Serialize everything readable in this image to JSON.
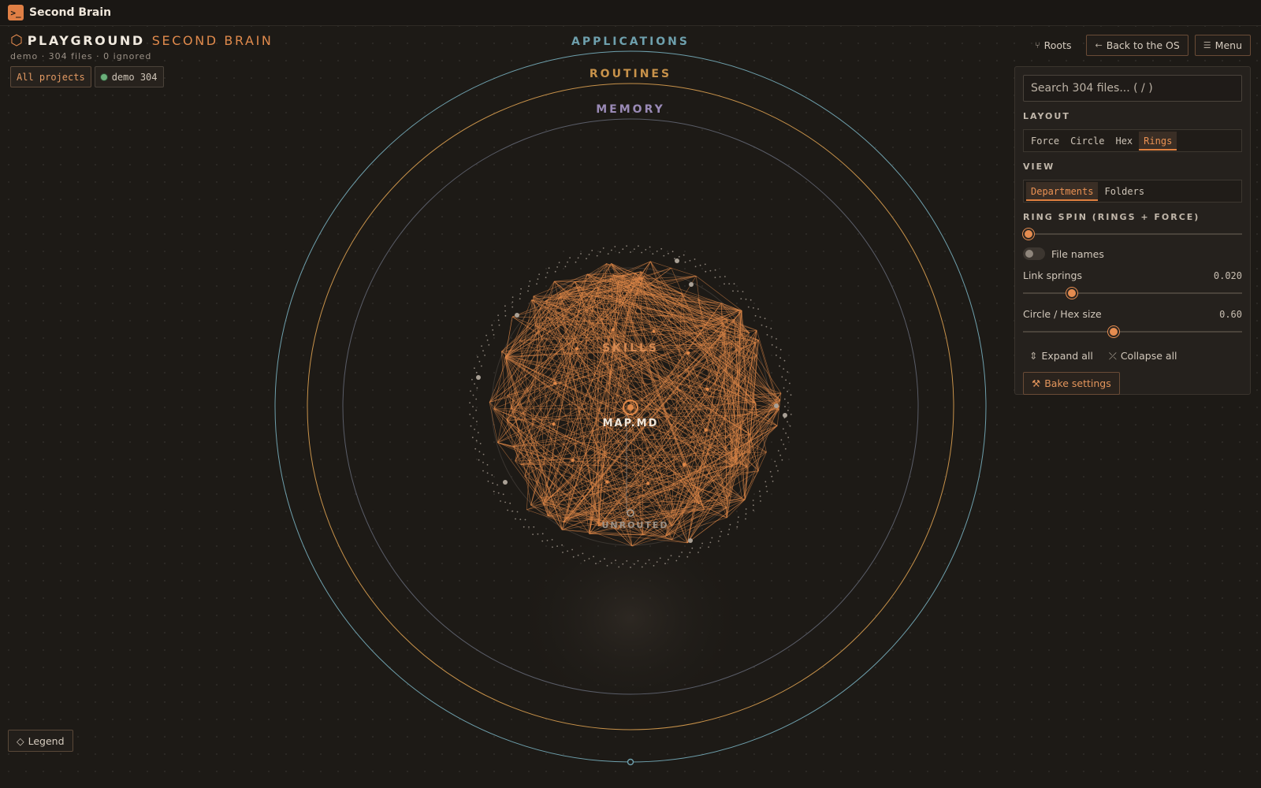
{
  "app": {
    "title": "Second Brain",
    "icon": "terminal-icon"
  },
  "header": {
    "brand_primary": "PLAYGROUND",
    "brand_secondary": "SECOND BRAIN",
    "subline": "demo · 304 files · 0 ignored",
    "chips": [
      {
        "label": "All projects"
      },
      {
        "label": "demo 304"
      }
    ]
  },
  "topbar": {
    "roots_label": "Roots",
    "back_label": "Back to the OS",
    "menu_label": "Menu"
  },
  "graph": {
    "rings": [
      {
        "label": "APPLICATIONS",
        "color": "#6ea0ad"
      },
      {
        "label": "ROUTINES",
        "color": "#c8924a"
      },
      {
        "label": "MEMORY",
        "color": "#9a8ab6"
      }
    ],
    "inner_label": "SKILLS",
    "center_label": "MAP.MD",
    "unrouted_label": "UNROUTED",
    "accent_color": "#e08848"
  },
  "panel": {
    "search_placeholder": "Search 304 files... ( / )",
    "layout_title": "LAYOUT",
    "layout_options": [
      "Force",
      "Circle",
      "Hex",
      "Rings"
    ],
    "layout_selected": "Rings",
    "view_title": "VIEW",
    "view_options": [
      "Departments",
      "Folders"
    ],
    "view_selected": "Departments",
    "ring_spin_title": "RING SPIN (RINGS + FORCE)",
    "ring_spin_value": 0,
    "file_names_label": "File names",
    "file_names_on": false,
    "link_springs_label": "Link springs",
    "link_springs_value": "0.020",
    "link_springs_fraction": 0.21,
    "circle_hex_label": "Circle / Hex size",
    "circle_hex_value": "0.60",
    "circle_hex_fraction": 0.41,
    "expand_label": "Expand all",
    "collapse_label": "Collapse all",
    "bake_label": "Bake settings"
  },
  "legend": {
    "label": "Legend"
  }
}
